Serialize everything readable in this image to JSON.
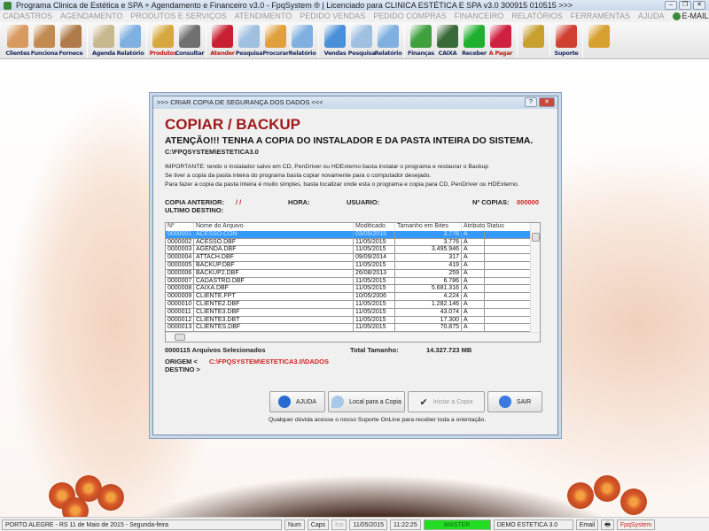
{
  "window": {
    "title": "Programa Clinica de Estética e SPA + Agendamento e Financeiro v3.0 - FpqSystem ® | Licenciado para  CLINICA ESTÉTICA E SPA v3.0 300915 010515 >>>",
    "controls": [
      "minimize",
      "restore",
      "close"
    ]
  },
  "menu": [
    "CADASTROS",
    "AGENDAMENTO",
    "PRODUTOS E SERVIÇOS",
    "ATENDIMENTO",
    "PEDIDO VENDAS",
    "PEDIDO COMPRAS",
    "FINANCEIRO",
    "RELATÓRIOS",
    "FERRAMENTAS",
    "AJUDA"
  ],
  "menu_email": "E-MAIL",
  "toolbar": [
    {
      "label": "Clientes",
      "color": "#d89a60"
    },
    {
      "label": "Funciona",
      "color": "#c08a50"
    },
    {
      "label": "Fornece",
      "color": "#b07a4a"
    },
    {
      "sep": true
    },
    {
      "label": "Agenda",
      "color": "#c8b890"
    },
    {
      "label": "Relatório",
      "color": "#80b0e0"
    },
    {
      "sep": true
    },
    {
      "label": "Produtos",
      "color": "#d8a840",
      "red": true
    },
    {
      "label": "Consultar",
      "color": "#707070"
    },
    {
      "sep": true
    },
    {
      "label": "Atender",
      "color": "#c82030",
      "red": true
    },
    {
      "label": "Pesquisa",
      "color": "#a0c0e0"
    },
    {
      "label": "Procurar",
      "color": "#e0a040"
    },
    {
      "label": "Relatório",
      "color": "#80b0e0"
    },
    {
      "sep": true
    },
    {
      "label": "Vendas",
      "color": "#4a90d8"
    },
    {
      "label": "Pesquisa",
      "color": "#a0c0e0"
    },
    {
      "label": "Relatório",
      "color": "#80b0e0"
    },
    {
      "sep": true
    },
    {
      "label": "Finanças",
      "color": "#40a040"
    },
    {
      "label": "CAIXA",
      "color": "#3a6a3a"
    },
    {
      "label": "Receber",
      "color": "#20b030"
    },
    {
      "label": "A Pagar",
      "color": "#d02040",
      "red": true
    },
    {
      "sep": true
    },
    {
      "label": "",
      "color": "#c8a030"
    },
    {
      "sep": true
    },
    {
      "label": "Suporte",
      "color": "#d04030"
    },
    {
      "sep": true
    },
    {
      "label": "",
      "color": "#d8a030"
    }
  ],
  "dialog": {
    "title": ">>> CRIAR COPIA DE SEGURANÇA DOS DADOS <<<",
    "heading": "COPIAR / BACKUP",
    "warning": "ATENÇÃO!!!  TENHA A COPIA DO  INSTALADOR  E  DA PASTA INTEIRA DO  SISTEMA.",
    "path": "C:\\FPQSYSTEM\\ESTETICA3.0",
    "info": [
      "IMPORTANTE: tendo o instalador salvo em CD, PenDriver ou HDExterno basta instalar o programa e restaurar o Backup",
      "Se tiver a copia da pasta inteira do programa basta copiar novamente para o computador desejado.",
      "Para fazer a copia da pasta inteira é muito simples, basta localizar onde esta o programa e copia para CD, PenDriver ou HDExterno."
    ],
    "copia_anterior_label": "COPIA ANTERIOR:",
    "copia_anterior": "/  /",
    "hora_label": "HORA:",
    "usuario_label": "USUARIO:",
    "ncopias_label": "Nº COPIAS:",
    "ncopias": "000000",
    "ultimo_destino_label": "ULTIMO DESTINO:",
    "columns": [
      "Nº",
      "Nome do Arquivo",
      "Modificado",
      "Tamanho em Bites",
      "Atributo",
      "Status"
    ],
    "rows": [
      [
        "0000001",
        "ACESSO.CON",
        "03/05/2015",
        "3.776",
        "A",
        ""
      ],
      [
        "0000002",
        "ACESSO.DBF",
        "11/05/2015",
        "3.776",
        "A",
        ""
      ],
      [
        "0000003",
        "AGENDA.DBF",
        "11/05/2015",
        "3.495.946",
        "A",
        ""
      ],
      [
        "0000004",
        "ATTACH.DBF",
        "09/09/2014",
        "317",
        "A",
        ""
      ],
      [
        "0000005",
        "BACKUP.DBF",
        "11/05/2015",
        "419",
        "A",
        ""
      ],
      [
        "0000006",
        "BACKUP2.DBF",
        "26/08/2013",
        "259",
        "A",
        ""
      ],
      [
        "0000007",
        "CADASTRO.DBF",
        "11/05/2015",
        "6.786",
        "A",
        ""
      ],
      [
        "0000008",
        "CAIXA.DBF",
        "11/05/2015",
        "5.681.316",
        "A",
        ""
      ],
      [
        "0000009",
        "CLIENTE.FPT",
        "10/05/2006",
        "4.224",
        "A",
        ""
      ],
      [
        "0000010",
        "CLIENTE2.DBF",
        "11/05/2015",
        "1.282.146",
        "A",
        ""
      ],
      [
        "0000011",
        "CLIENTE3.DBF",
        "11/05/2015",
        "43.074",
        "A",
        ""
      ],
      [
        "0000012",
        "CLIENTE3.DBT",
        "11/05/2015",
        "17.300",
        "A",
        ""
      ],
      [
        "0000013",
        "CLIENTES.DBF",
        "11/05/2015",
        "70.875",
        "A",
        ""
      ]
    ],
    "selected_count": "0000115 Arquivos Selecionados",
    "total_label": "Total Tamanho:",
    "total": "14.327.723 MB",
    "origem_label": "ORIGEM  <",
    "origem": "C:\\FPQSYSTEM\\ESTETICA3.0\\DADOS",
    "destino_label": "DESTINO >",
    "buttons": {
      "ajuda": "AJUDA",
      "local": "Local para a Copia",
      "iniciar": "Iniciar a Copia",
      "sair": "SAIR"
    },
    "footer": "Qualquer dúvida acesse o nosso Suporte OnLine para receber toda a orientação."
  },
  "status": {
    "location": "PORTO ALEGRE - RS 11 de Maio de 2015 - Segunda-feira",
    "num": "Num",
    "caps": "Caps",
    "ins": "Ins",
    "date": "11/05/2015",
    "time": "11:22:25",
    "user": "MASTER",
    "company": "DEMO ESTETICA 3.0",
    "email": "Email",
    "brand": "FpqSystem"
  }
}
